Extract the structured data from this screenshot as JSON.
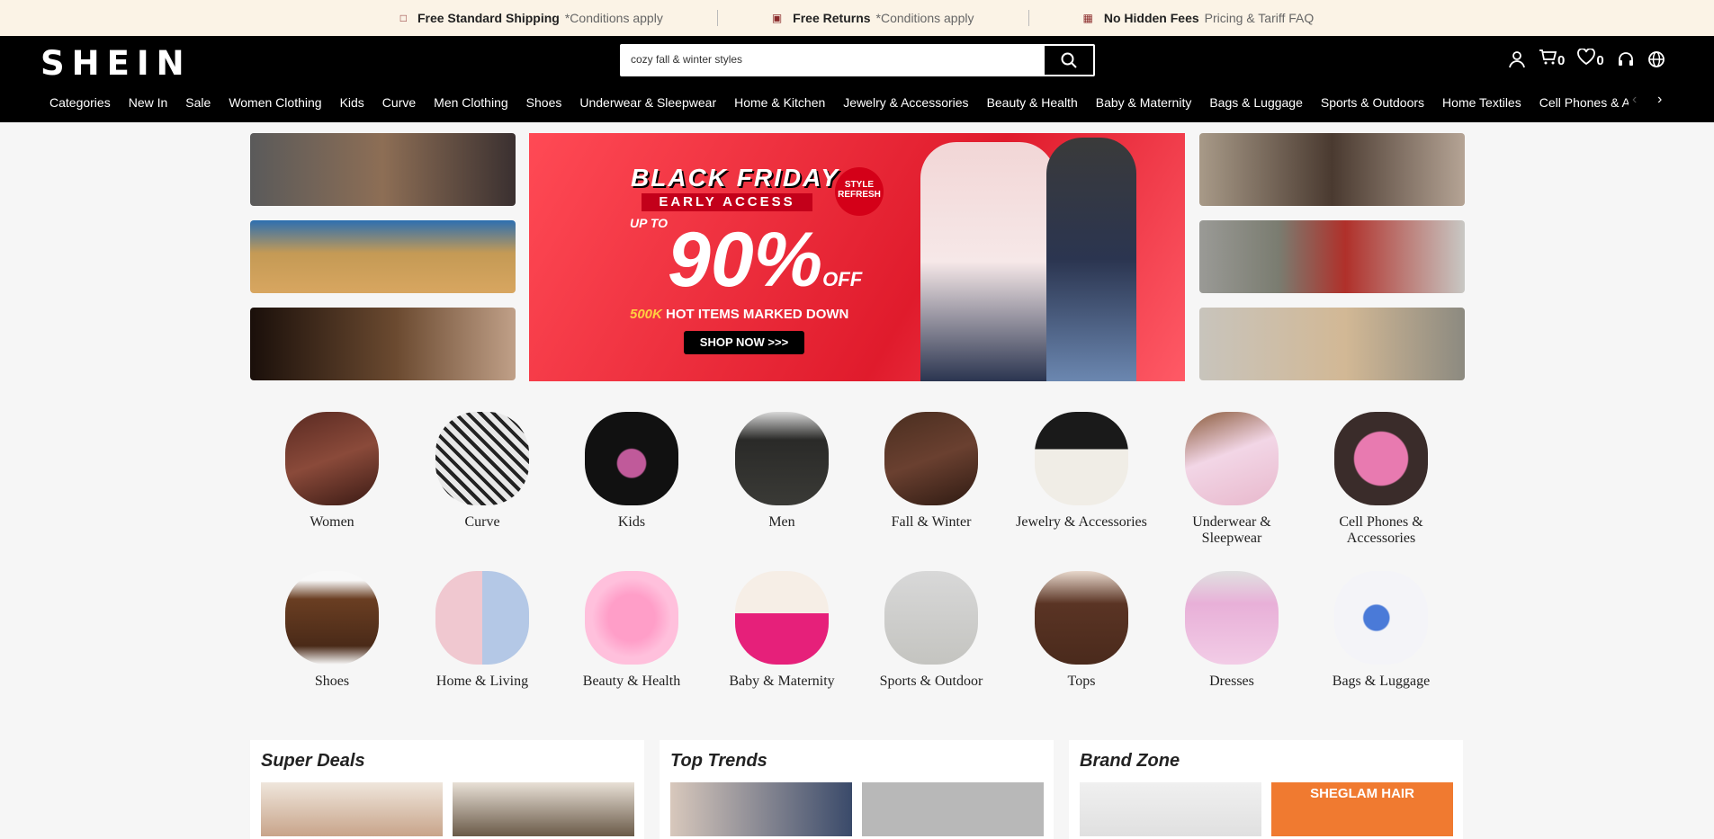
{
  "promo": [
    {
      "icon": "truck-icon",
      "bold": "Free Standard Shipping",
      "muted": "*Conditions apply"
    },
    {
      "icon": "return-box-icon",
      "bold": "Free Returns",
      "muted": "*Conditions apply"
    },
    {
      "icon": "document-icon",
      "bold": "No Hidden Fees",
      "muted": "Pricing & Tariff FAQ"
    }
  ],
  "header": {
    "logo": "SHEIN",
    "search_value": "cozy fall & winter styles",
    "cart_count": "0",
    "wishlist_count": "0"
  },
  "nav": [
    "Categories",
    "New In",
    "Sale",
    "Women Clothing",
    "Kids",
    "Curve",
    "Men Clothing",
    "Shoes",
    "Underwear & Sleepwear",
    "Home & Kitchen",
    "Jewelry & Accessories",
    "Beauty & Health",
    "Baby & Maternity",
    "Bags & Luggage",
    "Sports & Outdoors",
    "Home Textiles",
    "Cell Phones & Accessor"
  ],
  "hero": {
    "title": "BLACK FRIDAY",
    "subtitle": "EARLY ACCESS",
    "badge": "STYLE REFRESH",
    "discount": "90%",
    "upto": "UP TO",
    "off": "OFF",
    "items": "500K",
    "items_text": "HOT ITEMS MARKED DOWN",
    "cta": "SHOP NOW >>>"
  },
  "categories_row1": [
    "Women",
    "Curve",
    "Kids",
    "Men",
    "Fall & Winter",
    "Jewelry & Accessories",
    "Underwear & Sleepwear",
    "Cell Phones & Accessories"
  ],
  "categories_row2": [
    "Shoes",
    "Home & Living",
    "Beauty & Health",
    "Baby & Maternity",
    "Sports & Outdoor",
    "Tops",
    "Dresses",
    "Bags & Luggage"
  ],
  "cards": [
    {
      "title": "Super Deals"
    },
    {
      "title": "Top Trends"
    },
    {
      "title": "Brand Zone",
      "promo": "SHEGLAM HAIR"
    }
  ],
  "colors": {
    "accent": "#e01b2c",
    "banner_bg": "#fbf3e6",
    "header_bg": "#000000"
  }
}
